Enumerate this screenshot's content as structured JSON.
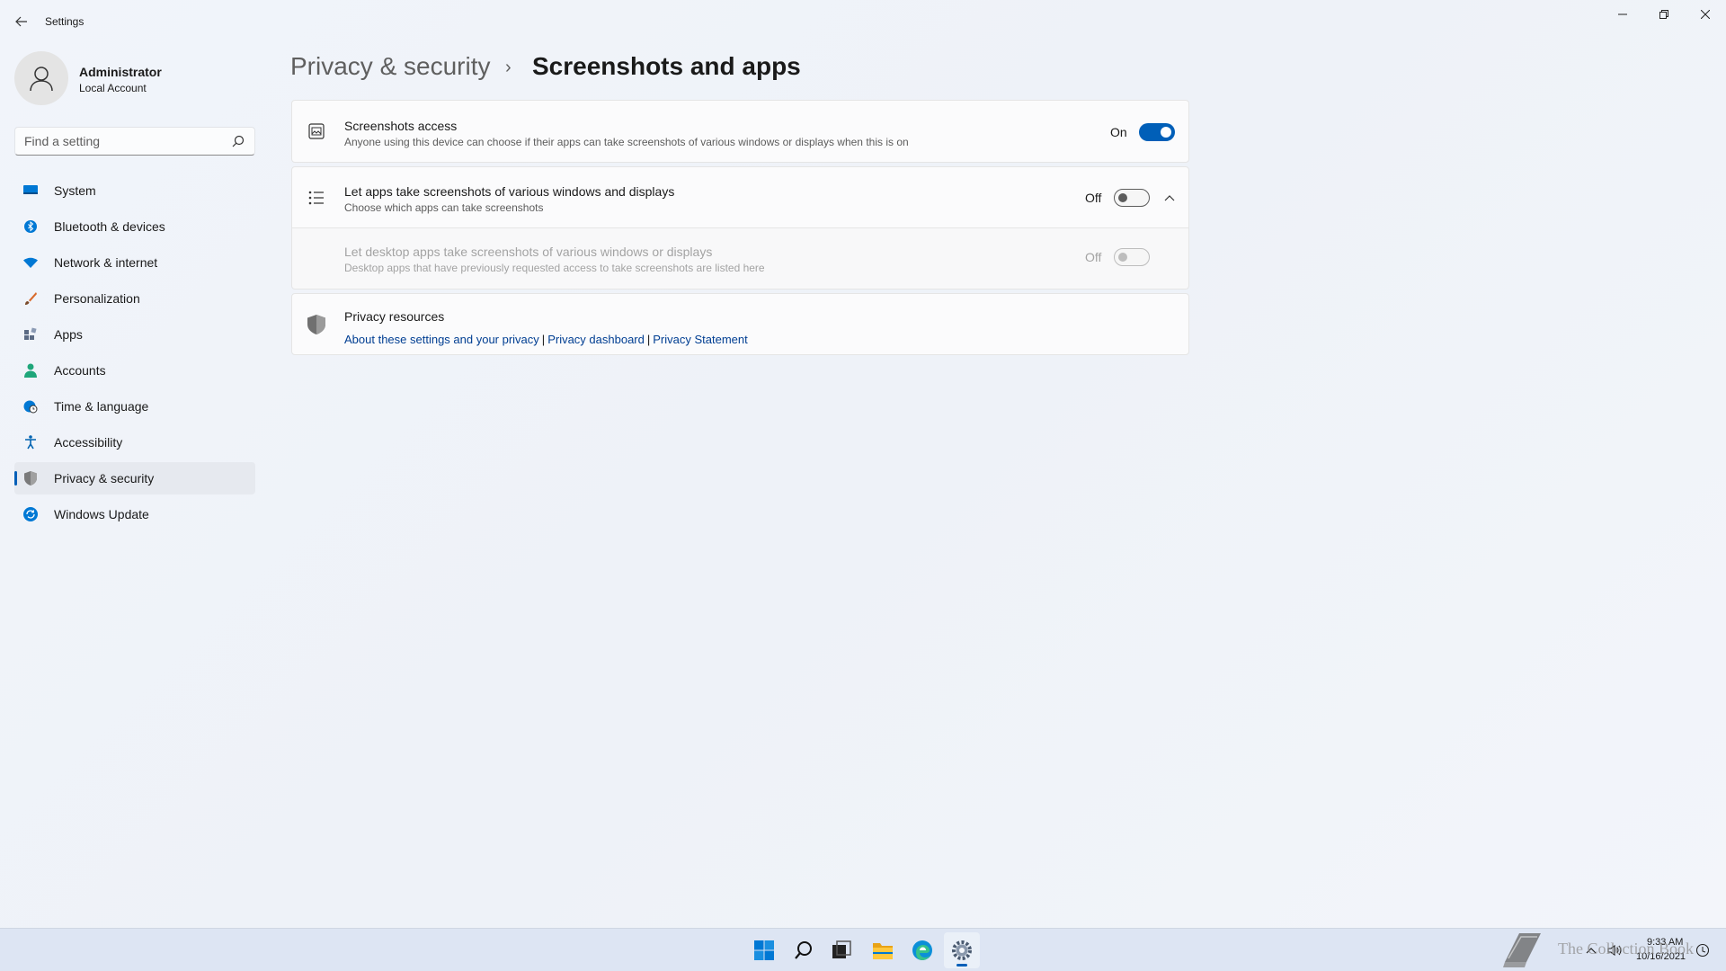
{
  "window": {
    "app_title": "Settings",
    "controls": {
      "minimize": "minimize",
      "maximize": "restore",
      "close": "close"
    }
  },
  "profile": {
    "name": "Administrator",
    "account_type": "Local Account"
  },
  "search": {
    "placeholder": "Find a setting"
  },
  "sidebar": {
    "items": [
      {
        "label": "System",
        "icon": "system-icon",
        "color": "#0078d4"
      },
      {
        "label": "Bluetooth & devices",
        "icon": "bluetooth-icon",
        "color": "#0078d4"
      },
      {
        "label": "Network & internet",
        "icon": "wifi-icon",
        "color": "#0078d4"
      },
      {
        "label": "Personalization",
        "icon": "brush-icon",
        "color": "#d86a2b"
      },
      {
        "label": "Apps",
        "icon": "apps-icon",
        "color": "#5b6b84"
      },
      {
        "label": "Accounts",
        "icon": "person-icon",
        "color": "#1fa67a"
      },
      {
        "label": "Time & language",
        "icon": "globe-clock-icon",
        "color": "#0078d4"
      },
      {
        "label": "Accessibility",
        "icon": "accessibility-icon",
        "color": "#0063b1"
      },
      {
        "label": "Privacy & security",
        "icon": "shield-icon",
        "color": "#6b6b6b",
        "active": true
      },
      {
        "label": "Windows Update",
        "icon": "update-icon",
        "color": "#0078d4"
      }
    ]
  },
  "breadcrumb": {
    "parent": "Privacy & security",
    "separator": "›",
    "current": "Screenshots and apps"
  },
  "settings": {
    "screenshots_access": {
      "title": "Screenshots access",
      "description": "Anyone using this device can choose if their apps can take screenshots of various windows or displays when this is on",
      "state_label": "On",
      "enabled": true
    },
    "let_apps": {
      "title": "Let apps take screenshots of various windows and displays",
      "description": "Choose which apps can take screenshots",
      "state_label": "Off",
      "enabled": false,
      "expanded": true
    },
    "let_desktop_apps": {
      "title": "Let desktop apps take screenshots of various windows or displays",
      "description": "Desktop apps that have previously requested access to take screenshots are listed here",
      "state_label": "Off",
      "enabled": false,
      "disabled": true
    },
    "privacy_resources": {
      "title": "Privacy resources",
      "links": [
        "About these settings and your privacy",
        "Privacy dashboard",
        "Privacy Statement"
      ],
      "separator": "|"
    }
  },
  "taskbar": {
    "apps": [
      "start-icon",
      "search-icon",
      "task-view-icon",
      "file-explorer-icon",
      "edge-icon",
      "settings-icon"
    ],
    "active_app": "settings-icon",
    "clock_time": "9:33 AM",
    "clock_date": "10/16/2021"
  },
  "watermark": {
    "text": "The Collection Book"
  },
  "colors": {
    "accent": "#005fb8",
    "link": "#003e92",
    "background": "#eef2f9"
  }
}
